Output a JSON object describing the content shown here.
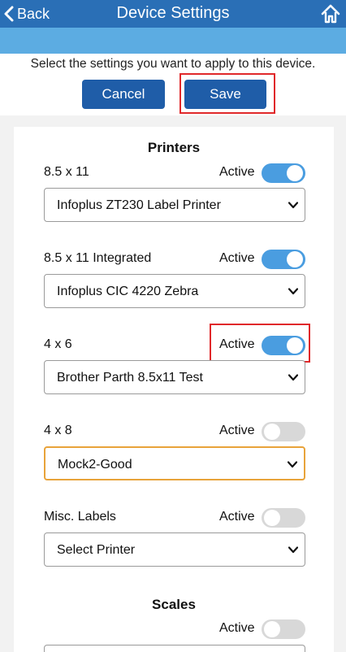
{
  "header": {
    "back_label": "Back",
    "title": "Device Settings"
  },
  "instructions": "Select the settings you want to apply to this device.",
  "buttons": {
    "cancel_label": "Cancel",
    "save_label": "Save"
  },
  "printers": {
    "section_title": "Printers",
    "active_label": "Active",
    "rows": [
      {
        "label": "8.5 x 11",
        "active": true,
        "selected": "Infoplus ZT230 Label Printer"
      },
      {
        "label": "8.5 x 11 Integrated",
        "active": true,
        "selected": "Infoplus CIC 4220 Zebra"
      },
      {
        "label": "4 x 6",
        "active": true,
        "selected": "Brother Parth 8.5x11 Test"
      },
      {
        "label": "4 x 8",
        "active": false,
        "selected": "Mock2-Good"
      },
      {
        "label": "Misc. Labels",
        "active": false,
        "selected": "Select Printer"
      }
    ]
  },
  "scales": {
    "section_title": "Scales",
    "active_label": "Active",
    "active": false
  },
  "colors": {
    "header_bg": "#2a6fb6",
    "subbar_bg": "#5cace2",
    "button_bg": "#1f5da8",
    "toggle_on": "#4a9de0",
    "toggle_off": "#d8d8d8",
    "highlight": "#e0282a",
    "focus_border": "#e8a33a"
  },
  "icons": [
    "chevron-left-icon",
    "home-icon",
    "chevron-down-icon"
  ]
}
